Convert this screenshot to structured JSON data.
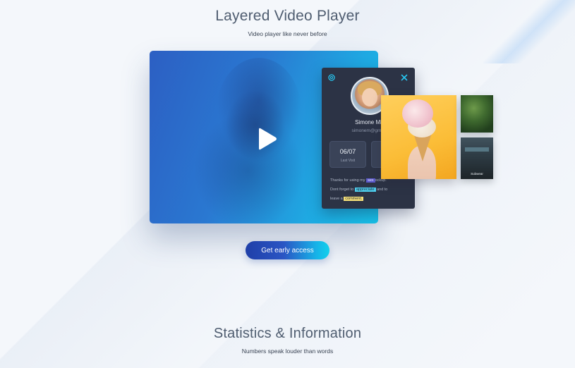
{
  "hero": {
    "title": "Layered Video Player",
    "subtitle": "Video player like never before",
    "cta_label": "Get early access"
  },
  "player": {
    "play_icon": "play-icon"
  },
  "profile_card": {
    "settings_icon": "gear-icon",
    "close_icon": "close-icon",
    "name": "Simone Mi",
    "email": "simonem@gmai",
    "stats": [
      {
        "value": "06/07",
        "label": "Last Visit"
      },
      {
        "value": "",
        "label": ""
      }
    ],
    "message": {
      "line1_prefix": "Thanks for using my",
      "line1_highlight": "sex",
      "line1_suffix": "ockup.",
      "line2_prefix": "Dont forget to",
      "line2_highlight": "appreciate",
      "line2_suffix": "and to",
      "line3_prefix": "leave a",
      "line3_highlight": "comment."
    }
  },
  "thumbnails": {
    "dark_label": "Subwear"
  },
  "stats_section": {
    "title": "Statistics & Information",
    "subtitle": "Numbers speak louder than words"
  },
  "colors": {
    "background": "#f4f7fb",
    "card_bg": "#2c3345",
    "accent_cyan": "#13d0ec",
    "accent_blue": "#1f3fa8",
    "icon_cyan": "#27c6f0"
  }
}
